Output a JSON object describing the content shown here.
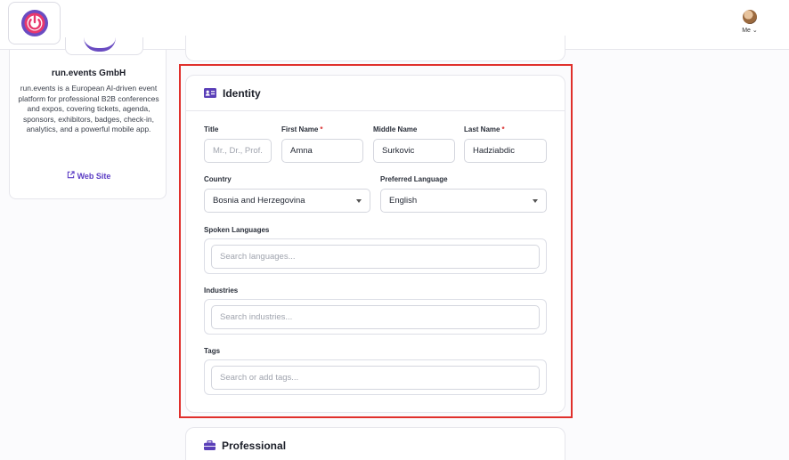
{
  "header": {
    "logo_icon": "power-icon",
    "user_label": "Me",
    "accent": "#6a4cc2"
  },
  "org": {
    "name": "run.events GmbH",
    "description": "run.events is a European AI-driven event platform for professional B2B conferences and expos, covering tickets, agenda, sponsors, exhibitors, badges, check-in, analytics, and a powerful mobile app.",
    "link_label": "Web Site",
    "link_icon": "external-link-icon"
  },
  "identity": {
    "title": "Identity",
    "icon": "id-card-icon",
    "fields": {
      "title_label": "Title",
      "title_placeholder": "Mr., Dr., Prof.",
      "title_value": "",
      "first_name_label": "First Name",
      "first_name_value": "Amna",
      "middle_name_label": "Middle Name",
      "middle_name_value": "Surkovic",
      "last_name_label": "Last Name",
      "last_name_value": "Hadziabdic",
      "required_mark": "*",
      "country_label": "Country",
      "country_value": "Bosnia and Herzegovina",
      "language_label": "Preferred Language",
      "language_value": "English",
      "spoken_label": "Spoken Languages",
      "spoken_placeholder": "Search languages...",
      "industries_label": "Industries",
      "industries_placeholder": "Search industries...",
      "tags_label": "Tags",
      "tags_placeholder": "Search or add tags..."
    }
  },
  "professional": {
    "title": "Professional",
    "icon": "briefcase-icon"
  },
  "colors": {
    "highlight": "#e0302c",
    "required": "#d92d2d",
    "link": "#5b3cc4"
  }
}
